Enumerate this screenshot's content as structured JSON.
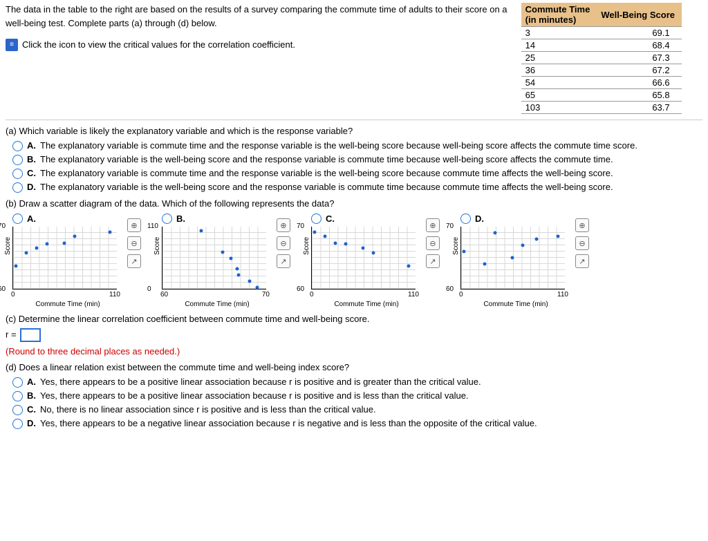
{
  "intro": "The data in the table to the right are based on the results of a survey comparing the commute time of adults to their score on a well-being test. Complete parts (a) through (d) below.",
  "link_text": "Click the icon to view the critical values for the correlation coefficient.",
  "table": {
    "h1a": "Commute Time",
    "h1b": "(in minutes)",
    "h2": "Well-Being Score",
    "rows": [
      {
        "c": "3",
        "s": "69.1"
      },
      {
        "c": "14",
        "s": "68.4"
      },
      {
        "c": "25",
        "s": "67.3"
      },
      {
        "c": "36",
        "s": "67.2"
      },
      {
        "c": "54",
        "s": "66.6"
      },
      {
        "c": "65",
        "s": "65.8"
      },
      {
        "c": "103",
        "s": "63.7"
      }
    ]
  },
  "a": {
    "q": "(a) Which variable is likely the explanatory variable and which is the response variable?",
    "opts": {
      "A": "The explanatory variable is commute time and the response variable is the well-being score because well-being score affects the commute time score.",
      "B": "The explanatory variable is the well-being score and the response variable is commute time because well-being score affects the commute time.",
      "C": "The explanatory variable is commute time and the response variable is the well-being score because commute time affects the well-being score.",
      "D": "The explanatory variable is the well-being score and the response variable is commute time because commute time affects the well-being score."
    }
  },
  "b": {
    "q": "(b) Draw a scatter diagram of the data. Which of the following represents the data?",
    "letters": {
      "A": "A.",
      "B": "B.",
      "C": "C.",
      "D": "D."
    },
    "ylabel": "Score",
    "xlabel": "Commute Time (min)"
  },
  "chart_data": [
    {
      "type": "scatter",
      "title": "A",
      "xlabel": "Commute Time (min)",
      "ylabel": "Score",
      "xlim": [
        0,
        110
      ],
      "ylim": [
        60,
        70
      ],
      "points": [
        [
          3,
          63.7
        ],
        [
          14,
          65.8
        ],
        [
          25,
          66.6
        ],
        [
          36,
          67.2
        ],
        [
          54,
          67.3
        ],
        [
          65,
          68.4
        ],
        [
          103,
          69.1
        ]
      ]
    },
    {
      "type": "scatter",
      "title": "B",
      "xlabel": "Commute Time (min)",
      "ylabel": "Score",
      "xlim": [
        60,
        70
      ],
      "ylim": [
        0,
        110
      ],
      "points": [
        [
          63.7,
          103
        ],
        [
          65.8,
          65
        ],
        [
          66.6,
          54
        ],
        [
          67.2,
          36
        ],
        [
          67.3,
          25
        ],
        [
          68.4,
          14
        ],
        [
          69.1,
          3
        ]
      ]
    },
    {
      "type": "scatter",
      "title": "C",
      "xlabel": "Commute Time (min)",
      "ylabel": "Score",
      "xlim": [
        0,
        110
      ],
      "ylim": [
        60,
        70
      ],
      "points": [
        [
          3,
          69.1
        ],
        [
          14,
          68.4
        ],
        [
          25,
          67.3
        ],
        [
          36,
          67.2
        ],
        [
          54,
          66.6
        ],
        [
          65,
          65.8
        ],
        [
          103,
          63.7
        ]
      ]
    },
    {
      "type": "scatter",
      "title": "D",
      "xlabel": "Commute Time (min)",
      "ylabel": "Score",
      "xlim": [
        0,
        110
      ],
      "ylim": [
        60,
        70
      ],
      "points": [
        [
          3,
          66
        ],
        [
          25,
          64
        ],
        [
          36,
          69
        ],
        [
          54,
          65
        ],
        [
          65,
          67
        ],
        [
          80,
          68
        ],
        [
          103,
          68.5
        ]
      ]
    }
  ],
  "c": {
    "q": "(c) Determine the linear correlation coefficient between commute time and well-being score.",
    "label": "r =",
    "inst": "(Round to three decimal places as needed.)"
  },
  "d": {
    "q": "(d) Does a linear relation exist between the commute time and well-being index score?",
    "opts": {
      "A": "Yes, there appears to be a positive linear association because r is positive and is greater than the critical value.",
      "B": "Yes, there appears to be a positive linear association because r is positive and is less than the critical value.",
      "C": "No, there is no linear association since r is positive and is less than the critical value.",
      "D": "Yes, there appears to be a negative linear association because r is negative and is less than the opposite of the critical value."
    }
  },
  "ticks": {
    "A": {
      "yt": "70",
      "yb": "60",
      "xl": "0",
      "xr": "110"
    },
    "B": {
      "yt": "110",
      "yb": "0",
      "xl": "60",
      "xr": "70"
    },
    "C": {
      "yt": "70",
      "yb": "60",
      "xl": "0",
      "xr": "110"
    },
    "D": {
      "yt": "70",
      "yb": "60",
      "xl": "0",
      "xr": "110"
    }
  },
  "l": {
    "A": "A.",
    "B": "B.",
    "C": "C.",
    "D": "D."
  }
}
